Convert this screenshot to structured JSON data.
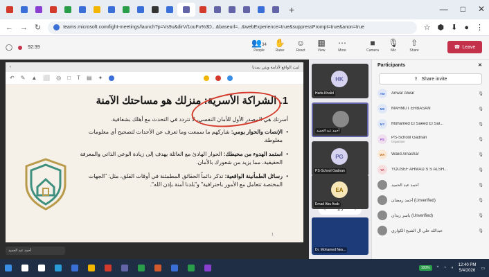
{
  "browser": {
    "url": "teams.microsoft.com/light-meetings/launch?p=Vs9u&dirV/1ouFu%3D...&baseurl=...&webExperience=true&suppressPrompt=true&anon=true",
    "new_tab": "+",
    "minimize": "—",
    "maximize": "□",
    "close": "✕",
    "back": "←",
    "forward": "→",
    "reload": "↻"
  },
  "tabs": [
    {
      "color": "#d33a2c"
    },
    {
      "color": "#3a6fd8"
    },
    {
      "color": "#8a3fd1"
    },
    {
      "color": "#d33a2c"
    },
    {
      "color": "#2a9d4b"
    },
    {
      "color": "#3a6fd8"
    },
    {
      "color": "#f2b600"
    },
    {
      "color": "#3a6fd8"
    },
    {
      "color": "#2a9d4b"
    },
    {
      "color": "#3a6fd8"
    },
    {
      "color": "#333333"
    },
    {
      "color": "#3a6fd8"
    },
    {
      "color": "#6264a7"
    },
    {
      "color": "#d33a2c"
    },
    {
      "color": "#6264a7"
    },
    {
      "color": "#6264a7"
    },
    {
      "color": "#6264a7"
    },
    {
      "color": "#3a6fd8"
    },
    {
      "color": "#6264a7"
    }
  ],
  "meeting": {
    "timer": "92:39",
    "tools": [
      {
        "icon": "people-icon",
        "label": "People",
        "count": "34"
      },
      {
        "icon": "raise-hand-icon",
        "label": "Raise"
      },
      {
        "icon": "react-icon",
        "label": "React"
      },
      {
        "icon": "view-icon",
        "label": "View"
      },
      {
        "icon": "more-icon",
        "label": "More"
      }
    ],
    "camera": "Camera",
    "mic": "Mic",
    "share": "Share",
    "leave": "Leave"
  },
  "presentation": {
    "header": "ليث الواقع لأدامة وبثي بمدنا",
    "pager": "1/5",
    "slide_number": "1",
    "presenter": "أحمد عبد الحميد",
    "title": "1. الشراكة الأسرية: منزلك هو مساحتك الآمنة",
    "lead": "أسرتك هي المصدر الأول للأمان النفسي، لا تتردد في التحدث مع أهلك بشفافية.",
    "bullets": [
      {
        "bold": "الإنصات والحوار يومي:",
        "text": " شاركهم ما سمعت وما تعرف عن الأحداث لتصحيح أي معلومات مغلوطة."
      },
      {
        "bold": "استمد الهدوء من محيطك:",
        "text": " الحوار الهادئ مع العائلة يهدف إلى زيادة الوعي الذاتي والمعرفة الحقيقية، مما يزيد من شعورك بالأمان."
      },
      {
        "bold": "رسائل الطمأنينة الواقعية:",
        "text": " تذكر دائماً الحقائق المطمئنة في أوقات القلق، مثل: \"الجهات المختصة تتعامل مع الأمور باحترافية\" و\"بلدنا آمنة بإذن الله\"."
      }
    ]
  },
  "gallery": [
    {
      "initials": "HK",
      "name": "Haifa Khalid",
      "color": "#d6d3f0",
      "text": "#6264a7"
    },
    {
      "initials": "",
      "name": "أحمد عبد الحميد",
      "color": "#8a8a8a",
      "text": "#fff"
    },
    {
      "initials": "PG",
      "name": "PS-School Gadnan",
      "color": "#d6d3f0",
      "text": "#6264a7"
    },
    {
      "initials": "EA",
      "name": "Emad Abu Arab",
      "color": "#f6e6b8",
      "text": "#9a6a00"
    },
    {
      "initials": "",
      "name": "Dr. Mohamed Nes...",
      "color": "#1c3b78",
      "text": "#fff"
    }
  ],
  "gallery_pager": "1/5",
  "participants": {
    "title": "Participants",
    "share_invite": "Share invite",
    "list": [
      {
        "initials": "AM",
        "name": "Anwar Alwar",
        "sub": "",
        "color": "#e0e7f7",
        "text": "#3a6fd8"
      },
      {
        "initials": "ME",
        "name": "MAHMUT ERBASAN",
        "sub": "",
        "color": "#e0e7f7",
        "text": "#3a6fd8"
      },
      {
        "initials": "MY",
        "name": "Mohamed El Saeed El Sal...",
        "sub": "",
        "color": "#e0e7f7",
        "text": "#3a6fd8"
      },
      {
        "initials": "PS",
        "name": "PS-School Gadnan",
        "sub": "Organizer",
        "color": "#f0e0ef",
        "text": "#8a3fd1"
      },
      {
        "initials": "WA",
        "name": "Walid Alnashar",
        "sub": "",
        "color": "#fbe9d8",
        "text": "#c06a14"
      },
      {
        "initials": "YA",
        "name": "YOUSEF AHMAD S S ALSH...",
        "sub": "",
        "color": "#f7dede",
        "text": "#c4314b"
      },
      {
        "initials": "",
        "name": "أحمد عبد الحميد",
        "sub": "",
        "color": "#8a8a8a",
        "text": "#fff"
      },
      {
        "initials": "",
        "name": "أحمد رمضان (Unverified)",
        "sub": "",
        "color": "#8a8a8a",
        "text": "#fff"
      },
      {
        "initials": "",
        "name": "ياسر زيدان (Unverified)",
        "sub": "",
        "color": "#8a8a8a",
        "text": "#fff"
      },
      {
        "initials": "",
        "name": "عبدالله علي ال الشيخ الكواري",
        "sub": "",
        "color": "#8a8a8a",
        "text": "#fff"
      }
    ]
  },
  "taskbar": {
    "battery": "100%",
    "time": "12:40 PM",
    "date": "5/4/2026",
    "apps": [
      {
        "icon": "windows-icon",
        "color": "#3a8ee6"
      },
      {
        "icon": "search-icon",
        "color": "#ffffff"
      },
      {
        "icon": "task-view-icon",
        "color": "#ffffff"
      },
      {
        "icon": "edge-icon",
        "color": "#2a9dd8"
      },
      {
        "icon": "store-icon",
        "color": "#3a6fd8"
      },
      {
        "icon": "files-icon",
        "color": "#f2b600"
      },
      {
        "icon": "chrome-icon",
        "color": "#d33a2c"
      },
      {
        "icon": "teams-icon",
        "color": "#6264a7"
      },
      {
        "icon": "app-icon",
        "color": "#2a9d4b"
      },
      {
        "icon": "powerpoint-icon",
        "color": "#d35a2c"
      },
      {
        "icon": "word-icon",
        "color": "#3a6fd8"
      },
      {
        "icon": "excel-icon",
        "color": "#2a9d4b"
      },
      {
        "icon": "app2-icon",
        "color": "#8a3fd1"
      }
    ]
  }
}
